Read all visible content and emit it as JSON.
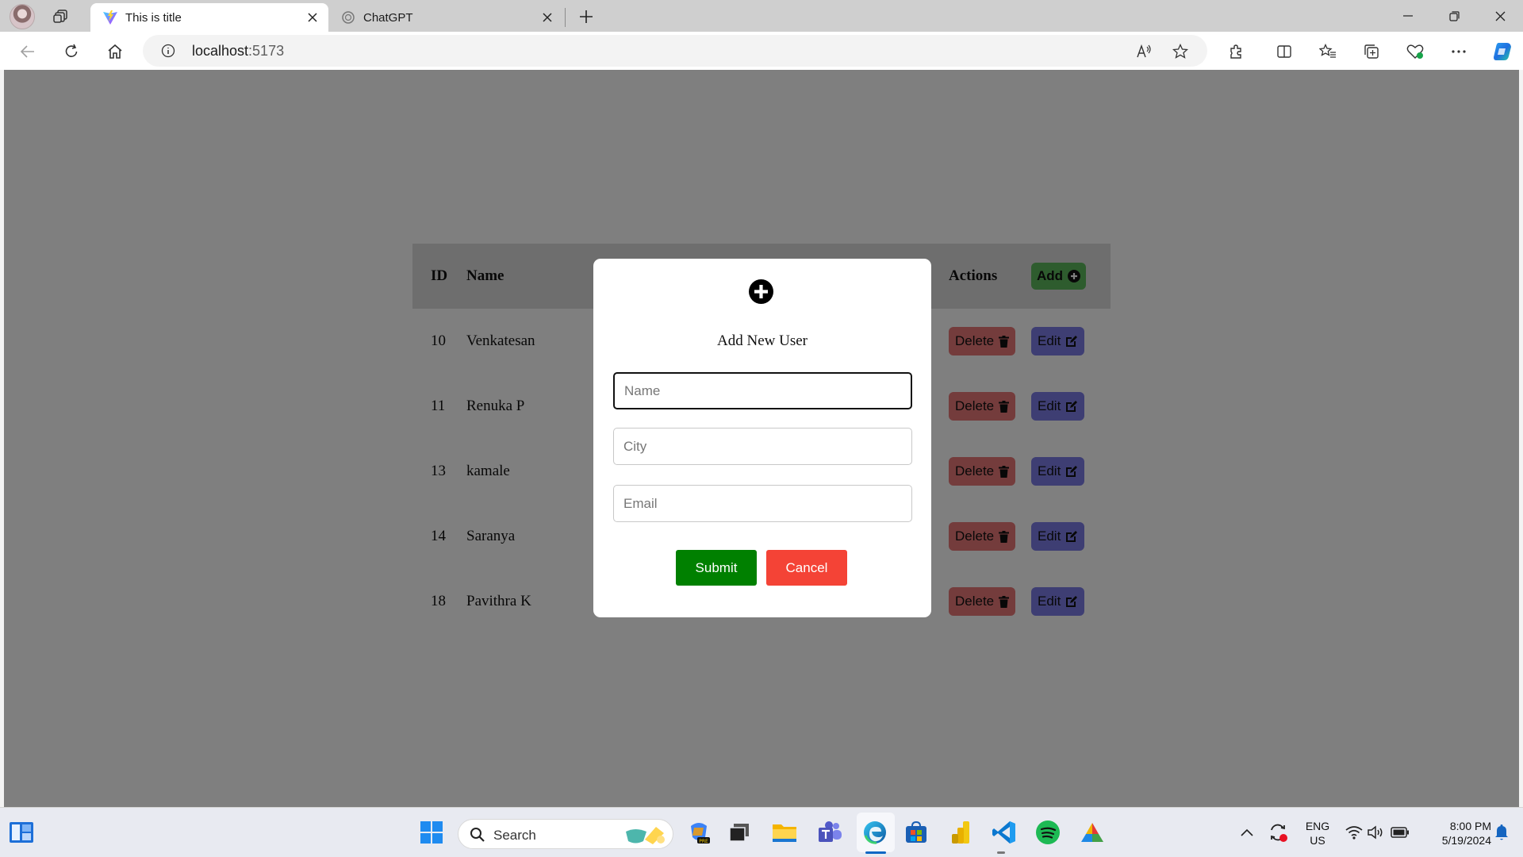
{
  "browser": {
    "tabs": [
      {
        "title": "This is title",
        "active": true,
        "icon": "vite-icon"
      },
      {
        "title": "ChatGPT",
        "active": false,
        "icon": "chatgpt-icon"
      }
    ],
    "address": {
      "host": "localhost",
      "port": ":5173"
    }
  },
  "table": {
    "headers": {
      "id": "ID",
      "name": "Name",
      "actions": "Actions"
    },
    "add_label": "Add",
    "delete_label": "Delete",
    "edit_label": "Edit",
    "rows": [
      {
        "id": "10",
        "name": "Venkatesan"
      },
      {
        "id": "11",
        "name": "Renuka P"
      },
      {
        "id": "13",
        "name": "kamale"
      },
      {
        "id": "14",
        "name": "Saranya"
      },
      {
        "id": "18",
        "name": "Pavithra K"
      }
    ]
  },
  "modal": {
    "title": "Add New User",
    "name_placeholder": "Name",
    "city_placeholder": "City",
    "email_placeholder": "Email",
    "submit_label": "Submit",
    "cancel_label": "Cancel"
  },
  "taskbar": {
    "search_label": "Search",
    "language": "ENG",
    "region": "US",
    "time": "8:00 PM",
    "date": "5/19/2024"
  },
  "colors": {
    "submit": "#008000",
    "cancel": "#f44336",
    "add": "#5cb85c",
    "delete": "#e87878",
    "edit": "#7d7de6",
    "overlay": "rgba(0,0,0,0.5)"
  }
}
